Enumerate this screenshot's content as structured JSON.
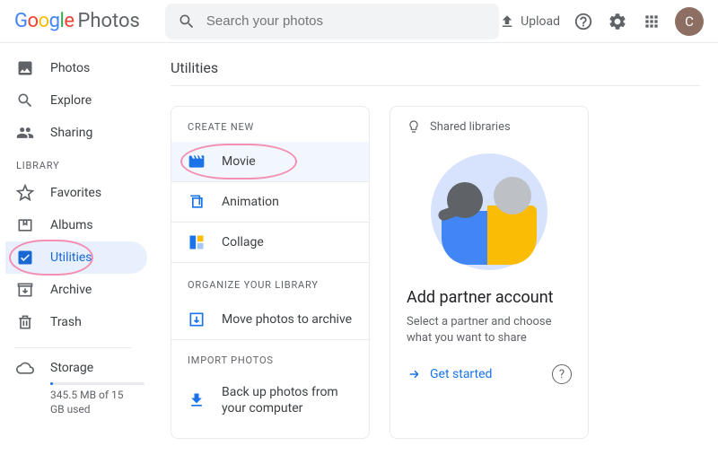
{
  "header": {
    "logo_sub": "Photos",
    "search_placeholder": "Search your photos",
    "upload_label": "Upload",
    "avatar_letter": "C"
  },
  "sidebar": {
    "items_top": [
      {
        "label": "Photos"
      },
      {
        "label": "Explore"
      },
      {
        "label": "Sharing"
      }
    ],
    "section_label": "LIBRARY",
    "items_lib": [
      {
        "label": "Favorites"
      },
      {
        "label": "Albums"
      },
      {
        "label": "Utilities"
      },
      {
        "label": "Archive"
      },
      {
        "label": "Trash"
      }
    ],
    "storage": {
      "label": "Storage",
      "used_text": "345.5 MB of 15 GB used"
    }
  },
  "main": {
    "title": "Utilities",
    "create": {
      "heading": "CREATE NEW",
      "items": [
        {
          "label": "Movie"
        },
        {
          "label": "Animation"
        },
        {
          "label": "Collage"
        }
      ]
    },
    "organize": {
      "heading": "ORGANIZE YOUR LIBRARY",
      "items": [
        {
          "label": "Move photos to archive"
        }
      ]
    },
    "import": {
      "heading": "IMPORT PHOTOS",
      "items": [
        {
          "label": "Back up photos from your computer"
        }
      ]
    },
    "partner": {
      "hint": "Shared libraries",
      "title": "Add partner account",
      "desc": "Select a partner and choose what you want to share",
      "cta": "Get started"
    }
  }
}
